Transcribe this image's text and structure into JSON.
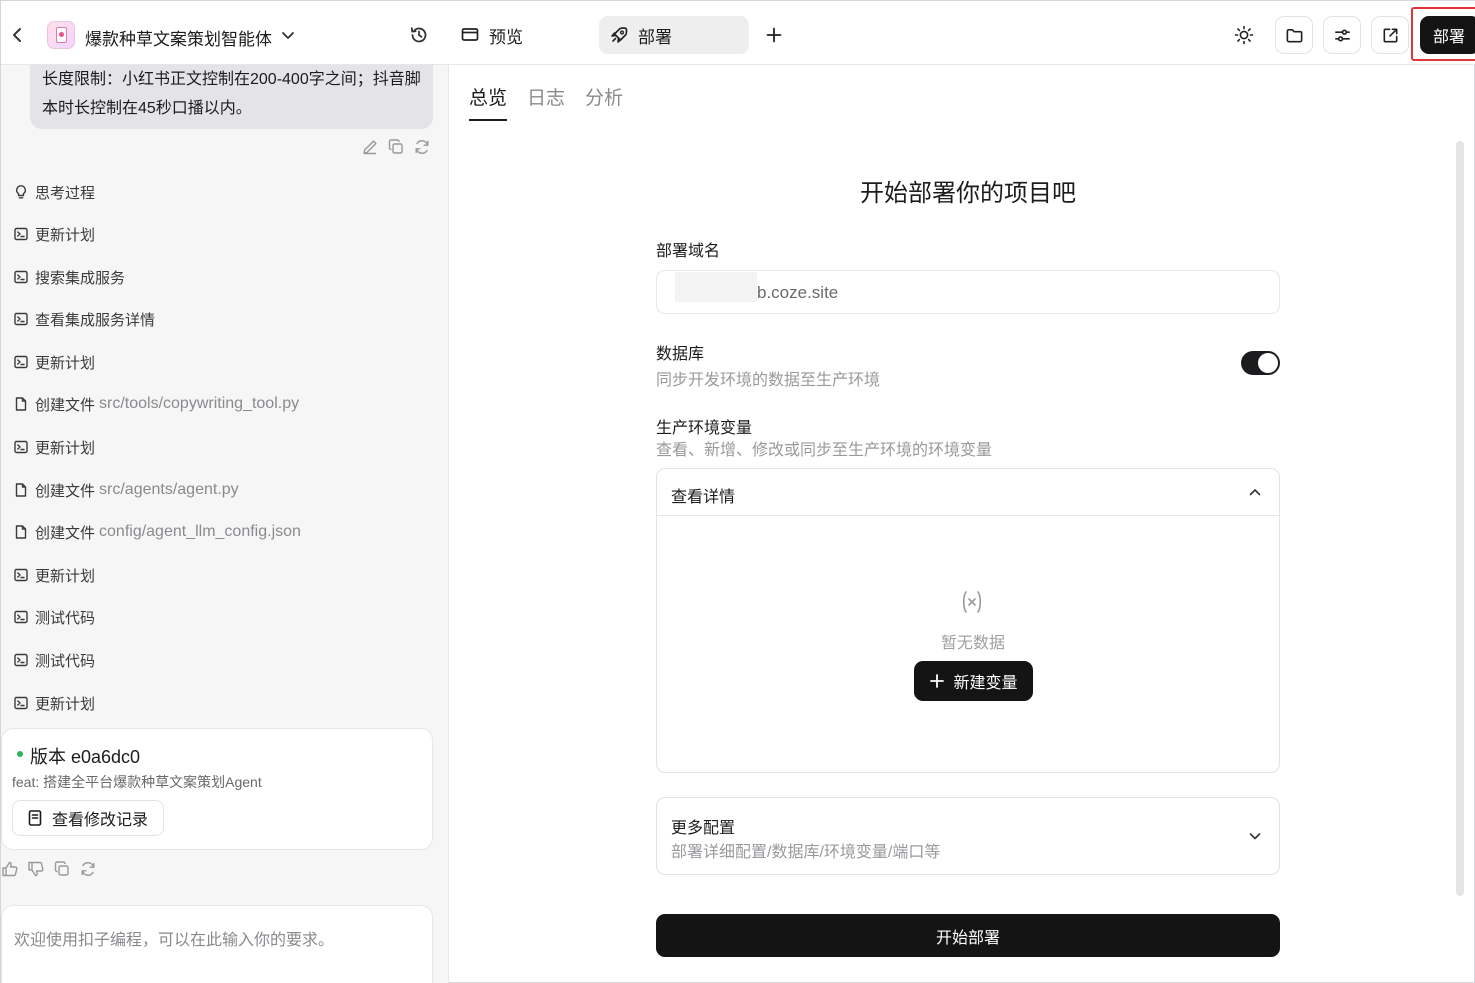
{
  "header": {
    "app_title": "爆款种草文案策划智能体",
    "tabs": [
      {
        "label": "预览",
        "icon": "monitor-icon"
      },
      {
        "label": "部署",
        "icon": "rocket-icon"
      }
    ],
    "deploy_button": "部署"
  },
  "chat": {
    "user_message": "长度限制：小红书正文控制在200-400字之间；抖音脚本时长控制在45秒口播以内。",
    "steps": [
      {
        "icon": "bulb-icon",
        "label": "思考过程",
        "path": ""
      },
      {
        "icon": "terminal-icon",
        "label": "更新计划",
        "path": ""
      },
      {
        "icon": "terminal-icon",
        "label": "搜索集成服务",
        "path": ""
      },
      {
        "icon": "terminal-icon",
        "label": "查看集成服务详情",
        "path": ""
      },
      {
        "icon": "terminal-icon",
        "label": "更新计划",
        "path": ""
      },
      {
        "icon": "file-icon",
        "label": "创建文件",
        "path": "src/tools/copywriting_tool.py"
      },
      {
        "icon": "terminal-icon",
        "label": "更新计划",
        "path": ""
      },
      {
        "icon": "file-icon",
        "label": "创建文件",
        "path": "src/agents/agent.py"
      },
      {
        "icon": "file-icon",
        "label": "创建文件",
        "path": "config/agent_llm_config.json"
      },
      {
        "icon": "terminal-icon",
        "label": "更新计划",
        "path": ""
      },
      {
        "icon": "terminal-icon",
        "label": "测试代码",
        "path": ""
      },
      {
        "icon": "terminal-icon",
        "label": "测试代码",
        "path": ""
      },
      {
        "icon": "terminal-icon",
        "label": "更新计划",
        "path": ""
      }
    ],
    "version": {
      "title": "版本 e0a6dc0",
      "description": "feat: 搭建全平台爆款种草文案策划Agent",
      "button": "查看修改记录",
      "status_color": "#2db35a"
    },
    "input_placeholder": "欢迎使用扣子编程，可以在此输入你的要求。"
  },
  "deploy": {
    "sub_tabs": [
      "总览",
      "日志",
      "分析"
    ],
    "active_sub_tab": "总览",
    "title": "开始部署你的项目吧",
    "domain_label": "部署域名",
    "domain_value": "b.coze.site",
    "database_label": "数据库",
    "database_desc": "同步开发环境的数据至生产环境",
    "database_sync_enabled": true,
    "env_label": "生产环境变量",
    "env_desc": "查看、新增、修改或同步至生产环境的环境变量",
    "details_title": "查看详情",
    "empty_text": "暂无数据",
    "new_var_button": "新建变量",
    "more_title": "更多配置",
    "more_desc": "部署详细配置/数据库/环境变量/端口等",
    "start_button": "开始部署"
  },
  "colors": {
    "primary_dark": "#141414",
    "highlight_red": "#e2353a",
    "panel_bg": "#f6f6f7"
  }
}
